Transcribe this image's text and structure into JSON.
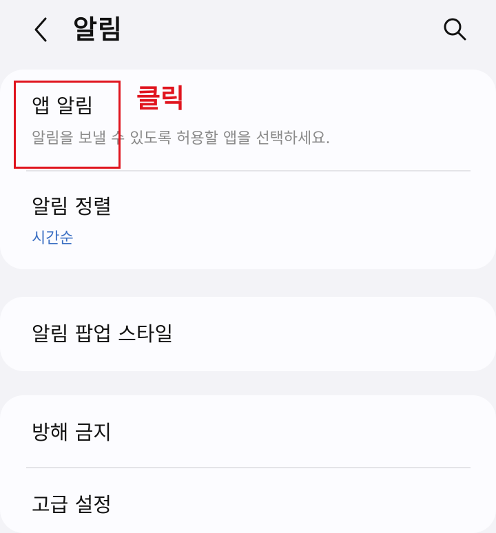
{
  "header": {
    "title": "알림",
    "back_icon": "chevron-left-icon",
    "search_icon": "search-icon"
  },
  "settings": {
    "app_notifications": {
      "title": "앱 알림",
      "description": "알림을 보낼 수 있도록 허용할 앱을 선택하세요."
    },
    "notification_sorting": {
      "title": "알림 정렬",
      "value": "시간순"
    },
    "popup_style": {
      "title": "알림 팝업 스타일"
    },
    "do_not_disturb": {
      "title": "방해 금지"
    },
    "advanced": {
      "title": "고급 설정"
    }
  },
  "annotation": {
    "label": "클릭",
    "color": "#e0141e"
  },
  "colors": {
    "background": "#f3f3f7",
    "card": "#fcfcff",
    "accent_blue": "#3b6fc3",
    "secondary_text": "#8a8a8a"
  }
}
